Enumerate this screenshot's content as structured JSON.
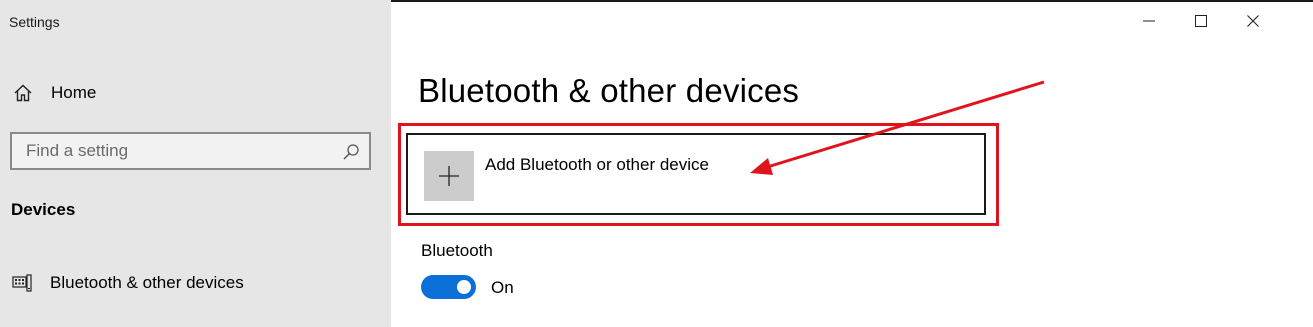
{
  "window": {
    "app_title": "Settings",
    "controls": [
      "minimize",
      "maximize",
      "close"
    ]
  },
  "sidebar": {
    "home_label": "Home",
    "search_placeholder": "Find a setting",
    "section_header": "Devices",
    "items": [
      {
        "label": "Bluetooth & other devices",
        "icon": "bluetooth-devices-icon"
      }
    ]
  },
  "main": {
    "title": "Bluetooth & other devices",
    "add_device_label": "Add Bluetooth or other device",
    "bluetooth_label": "Bluetooth",
    "bluetooth_toggle_state": "On"
  },
  "annotation": {
    "highlight_color": "#e0141c",
    "arrow_color": "#e0141c"
  },
  "colors": {
    "sidebar_bg": "#e6e6e6",
    "accent": "#0a6fd6",
    "tile_bg": "#cccccc"
  }
}
